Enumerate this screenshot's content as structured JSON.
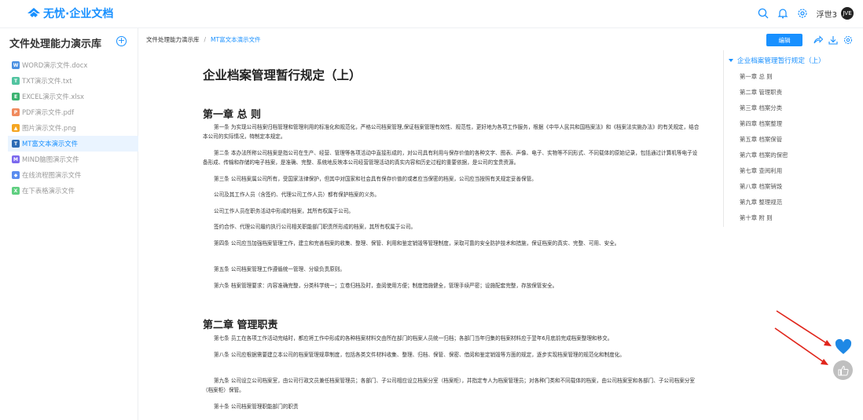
{
  "topbar": {
    "logo_text": "无忧·企业文档",
    "username": "浮世3",
    "avatar_text": "JVE",
    "icons": [
      "search-icon",
      "bell-icon",
      "settings-icon"
    ]
  },
  "sidebar": {
    "library_title": "文件处理能力演示库",
    "add_label": "+",
    "files": [
      {
        "name": "WORD演示文件.docx",
        "icon": "W",
        "color": "#4a90e2",
        "active": false
      },
      {
        "name": "TXT演示文件.txt",
        "icon": "T",
        "color": "#52c4a0",
        "active": false
      },
      {
        "name": "EXCEL演示文件.xlsx",
        "icon": "E",
        "color": "#3cb371",
        "active": false
      },
      {
        "name": "PDF演示文件.pdf",
        "icon": "P",
        "color": "#f08a5d",
        "active": false
      },
      {
        "name": "图片演示文件.png",
        "icon": "▲",
        "color": "#f5a623",
        "active": false
      },
      {
        "name": "MT富文本演示文件",
        "icon": "T",
        "color": "#2d6cb5",
        "active": true
      },
      {
        "name": "MIND脑图演示文件",
        "icon": "M",
        "color": "#7b68ee",
        "active": false
      },
      {
        "name": "在线流程图演示文件",
        "icon": "◆",
        "color": "#5b8def",
        "active": false
      },
      {
        "name": "在下表格演示文件",
        "icon": "X",
        "color": "#5fcf80",
        "active": false
      }
    ]
  },
  "breadcrumb": {
    "root": "文件处理能力演示库",
    "separator": "/",
    "current": "MT富文本演示文件"
  },
  "toolbar": {
    "edit_label": "编辑",
    "icons": [
      "share-icon",
      "download-icon",
      "settings-icon"
    ]
  },
  "document": {
    "title": "企业档案管理暂行规定（上）",
    "chapter1": {
      "title": "第一章 总 则",
      "paragraphs": [
        "第一条 为实现公司档案归档管理和管理利用的标准化和规范化，严格公司档案管理,保证档案管理有效性、规范性，更好地为各项工作服务，根据《中华人民共和国档案法》和《档案法实施办法》的有关规定，结合本公司的实际情况，特制定本规定。",
        "第二条 本办法所称公司档案是指公司在生产、经营、管理等各项活动中直接形成的，对公司具有利用与保存价值的各种文字、图表、声像、电子、实物等不同形式、不同载体的原始记录，包括通过计算机等电子设备形成、传输和存储的电子档案，是准确、完整、系统地反映本公司经营管理活动的真实内容和历史过程的重要依据，是公司的宝贵资源。",
        "第三条 公司档案属公司所有，受国家法律保护，但其中对国家和社会具有保存价值的或者应当保密的档案，公司应当按照有关规定妥善保管。",
        "公司及其工作人员（含签约、代理公司工作人员）都有保护档案的义务。",
        "公司工作人员在职务活动中形成的档案，其所有权属于公司。",
        "签约合作、代理公司履约执行公司相关职能部门职责所形成的档案，其所有权属于公司。",
        "第四条 公司应当加强档案管理工作，建立和完善档案的收集、整理、保管、利用和鉴定销毁等管理制度，采取可靠的安全防护技术和措施，保证档案的真实、完整、可用、安全。",
        "第五条 公司档案管理工作遵循统一管理、分级负责原则。",
        "第六条 档案管理要求：内容准确完整，分类科学统一；立卷归档及时，查阅使用方便；制度措施健全，管理手续严密；设施配套完整，存放保管安全。"
      ]
    },
    "chapter2": {
      "title": "第二章 管理职责",
      "paragraphs": [
        "第七条 员工在各项工作活动完结时，都应将工作中形成的各种档案材料交由所在部门的档案人员统一归档；各部门当年归集的档案材料应于翌年6月底前完成档案整理和移交。",
        "第八条 公司应根据需要建立本公司的档案管理规章制度，包括各类文件材料收集、整理、归档、保管、保密、借阅和鉴定销毁等方面的规定，逐步实现档案管理的规范化和制度化。",
        "第九条 公司设立公司档案室，由公司行政文员兼任档案管理员；各部门、子公司相应设立档案分室（档案柜），并指定专人为档案管理员；对各种门类和不同载体的档案，由公司档案室和各部门、子公司档案分室（档案柜）保管。",
        "第十条 公司档案管理职能部门的职责"
      ]
    }
  },
  "toc": {
    "title": "企业档案管理暂行规定（上）",
    "items": [
      "第一章 总 则",
      "第二章 管理职责",
      "第三章 档案分类",
      "第四章 档案整理",
      "第五章 档案保管",
      "第六章 档案的保密",
      "第七章 查阅利用",
      "第八章 档案销毁",
      "第九章 整理规范",
      "第十章 附 则"
    ]
  },
  "colors": {
    "accent": "#1890ff",
    "active_bg": "#eaf4ff",
    "arrow": "#e0251b"
  },
  "floating": {
    "icons": [
      "heart-icon",
      "thumbs-up-icon"
    ]
  }
}
